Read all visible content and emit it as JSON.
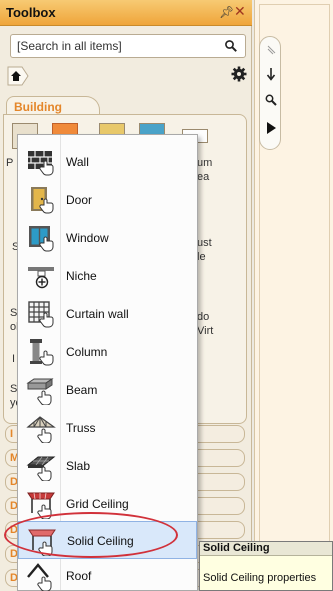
{
  "panel": {
    "title": "Toolbox"
  },
  "search": {
    "placeholder": "[Search in all items]"
  },
  "category": {
    "label": "Building"
  },
  "behind_panel": {
    "peek_left": [
      "P",
      "S",
      "Si",
      "ol",
      "I",
      "S",
      "ye"
    ],
    "peek_right": [
      "um",
      "ea",
      "ust",
      "le",
      "do",
      "Virt"
    ],
    "collapsed_rows": [
      "I",
      "M",
      "D",
      "D",
      "D",
      "D",
      "D"
    ]
  },
  "menu": {
    "items": [
      {
        "label": "Wall",
        "icon": "wall-icon"
      },
      {
        "label": "Door",
        "icon": "door-icon"
      },
      {
        "label": "Window",
        "icon": "window-icon"
      },
      {
        "label": "Niche",
        "icon": "niche-icon"
      },
      {
        "label": "Curtain wall",
        "icon": "curtain-wall-icon"
      },
      {
        "label": "Column",
        "icon": "column-icon"
      },
      {
        "label": "Beam",
        "icon": "beam-icon"
      },
      {
        "label": "Truss",
        "icon": "truss-icon"
      },
      {
        "label": "Slab",
        "icon": "slab-icon"
      },
      {
        "label": "Grid Ceiling",
        "icon": "grid-ceiling-icon"
      },
      {
        "label": "Solid Ceiling",
        "icon": "solid-ceiling-icon",
        "selected": true
      },
      {
        "label": "Roof",
        "icon": "roof-icon"
      }
    ]
  },
  "tooltip": {
    "title": "Solid Ceiling",
    "description": "Solid Ceiling properties"
  },
  "colors": {
    "title_bar": "#efa53a",
    "category_text": "#e4862a",
    "selection_bg": "#d9e8fa",
    "highlight_ring": "#d1313a",
    "tooltip_bg": "#ffffe1"
  }
}
